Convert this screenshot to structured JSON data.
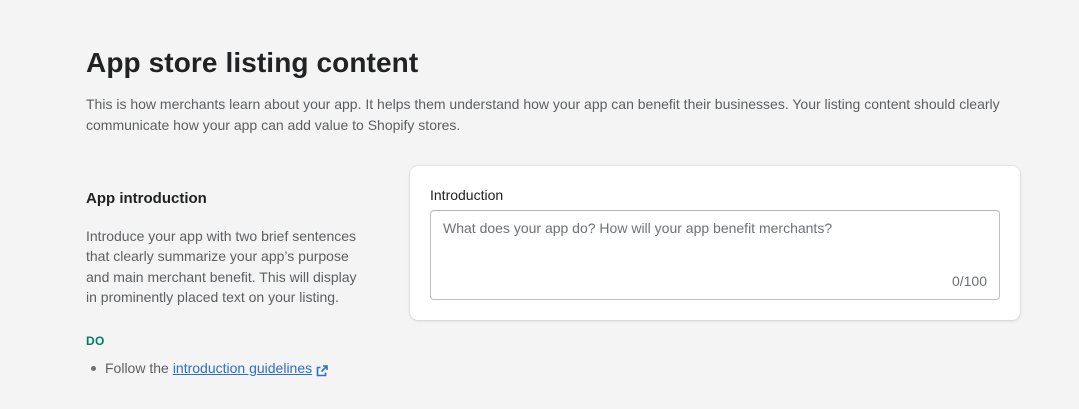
{
  "header": {
    "title": "App store listing content",
    "description": "This is how merchants learn about your app. It helps them understand how your app can benefit their businesses. Your listing content should clearly communicate how your app can add value to Shopify stores."
  },
  "section": {
    "title": "App introduction",
    "description": "Introduce your app with two brief sentences that clearly summarize your app’s purpose and main merchant benefit. This will display in prominently placed text on your listing.",
    "do_label": "DO",
    "guidelines": [
      {
        "prefix": "Follow the",
        "link_text": "introduction guidelines",
        "icon": "external-link-icon"
      }
    ]
  },
  "card": {
    "field_label": "Introduction",
    "value": "",
    "placeholder": "What does your app do? How will your app benefit merchants?",
    "char_count": "0/100"
  },
  "colors": {
    "background": "#f4f4f4",
    "text": "#202223",
    "subdued": "#5c5f62",
    "do_green": "#007f5f",
    "link": "#2c6ecb"
  }
}
